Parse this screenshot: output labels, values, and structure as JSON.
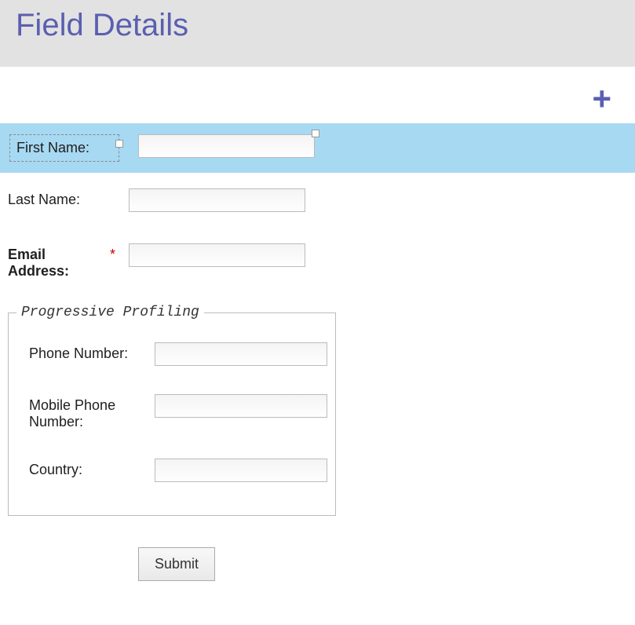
{
  "header": {
    "title": "Field Details"
  },
  "toolbar": {
    "add_icon": "plus"
  },
  "fields": {
    "first_name": {
      "label": "First Name:",
      "value": "",
      "required": false,
      "selected": true
    },
    "last_name": {
      "label": "Last Name:",
      "value": "",
      "required": false
    },
    "email": {
      "label": "Email Address:",
      "value": "",
      "required": true,
      "required_mark": "*"
    }
  },
  "progressive": {
    "legend": "Progressive Profiling",
    "phone": {
      "label": "Phone Number:",
      "value": ""
    },
    "mobile": {
      "label": "Mobile Phone Number:",
      "value": ""
    },
    "country": {
      "label": "Country:",
      "value": ""
    }
  },
  "actions": {
    "submit_label": "Submit"
  }
}
